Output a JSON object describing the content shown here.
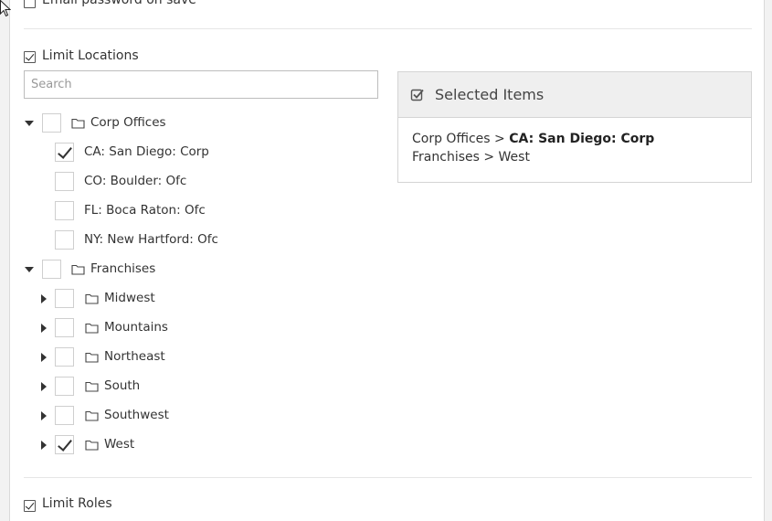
{
  "options": {
    "email_password": {
      "label": "Email password on save",
      "checked": false
    },
    "limit_locations": {
      "label": "Limit Locations",
      "checked": true
    },
    "limit_roles": {
      "label": "Limit Roles",
      "checked": true
    }
  },
  "search": {
    "placeholder": "Search",
    "value": ""
  },
  "tree": {
    "corp_offices": {
      "label": "Corp Offices",
      "expanded": true,
      "checked": false,
      "children": [
        {
          "label": "CA: San Diego: Corp",
          "checked": true
        },
        {
          "label": "CO: Boulder: Ofc",
          "checked": false
        },
        {
          "label": "FL: Boca Raton: Ofc",
          "checked": false
        },
        {
          "label": "NY: New Hartford: Ofc",
          "checked": false
        }
      ]
    },
    "franchises": {
      "label": "Franchises",
      "expanded": true,
      "checked": false,
      "children": [
        {
          "label": "Midwest",
          "checked": false,
          "expanded": false
        },
        {
          "label": "Mountains",
          "checked": false,
          "expanded": false
        },
        {
          "label": "Northeast",
          "checked": false,
          "expanded": false
        },
        {
          "label": "South",
          "checked": false,
          "expanded": false
        },
        {
          "label": "Southwest",
          "checked": false,
          "expanded": false
        },
        {
          "label": "West",
          "checked": true,
          "expanded": false
        }
      ]
    }
  },
  "selected_items": {
    "title": "Selected Items",
    "items": [
      {
        "path": "Corp Offices > ",
        "leaf": "CA: San Diego: Corp"
      },
      {
        "path": "Franchises > West",
        "leaf": ""
      }
    ]
  },
  "icons": {
    "folder": "folder-outline-icon",
    "selected_header": "check-square-icon",
    "expand": "caret-down-icon",
    "collapse": "caret-right-icon",
    "pointer": "mouse-pointer-icon"
  }
}
